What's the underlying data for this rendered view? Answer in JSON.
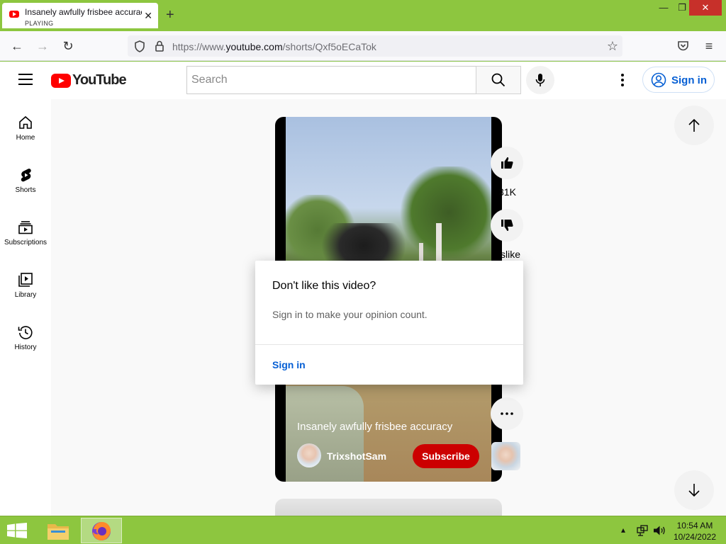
{
  "browser": {
    "tab_title": "Insanely awfully frisbee accuracy",
    "tab_status": "PLAYING",
    "url_prefix": "https://www.",
    "url_domain": "youtube.com",
    "url_path": "/shorts/Qxf5oECaTok"
  },
  "yt": {
    "logo_text": "YouTube",
    "search_placeholder": "Search",
    "sign_in": "Sign in"
  },
  "guide": [
    {
      "label": "Home"
    },
    {
      "label": "Shorts"
    },
    {
      "label": "Subscriptions"
    },
    {
      "label": "Library"
    },
    {
      "label": "History"
    }
  ],
  "short": {
    "title": "Insanely awfully frisbee accuracy",
    "channel": "TrixshotSam",
    "subscribe": "Subscribe",
    "like_count": "31K",
    "dislike_label": "slike",
    "more_icon": "more-horizontal-icon"
  },
  "popup": {
    "heading": "Don't like this video?",
    "body": "Sign in to make your opinion count.",
    "action": "Sign in"
  },
  "taskbar": {
    "time": "10:54 AM",
    "date": "10/24/2022"
  },
  "colors": {
    "yt_red": "#ff0000",
    "subscribe_red": "#cc0000",
    "link_blue": "#065fd4",
    "desktop_green": "#8dc63f"
  }
}
